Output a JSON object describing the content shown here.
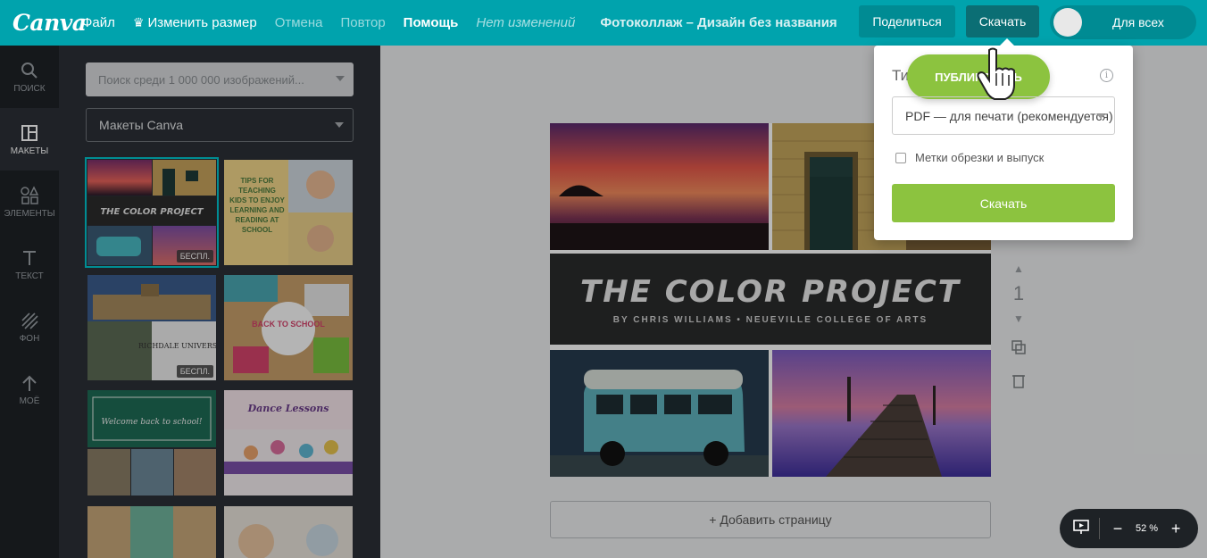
{
  "topbar": {
    "logo": "Canva",
    "menu": {
      "file": "Файл",
      "resize": "Изменить размер",
      "undo": "Отмена",
      "redo": "Повтор",
      "help": "Помощь",
      "status": "Нет изменений"
    },
    "title": "Фотоколлаж – Дизайн без названия",
    "share_label": "Поделиться",
    "download_label": "Скачать",
    "visibility_label": "Для всех"
  },
  "rail": {
    "items": [
      {
        "label": "Поиск",
        "icon": "search-icon"
      },
      {
        "label": "Макеты",
        "icon": "layout-icon"
      },
      {
        "label": "Элементы",
        "icon": "shapes-icon"
      },
      {
        "label": "Текст",
        "icon": "text-icon"
      },
      {
        "label": "Фон",
        "icon": "background-icon"
      },
      {
        "label": "Моё",
        "icon": "upload-icon"
      }
    ]
  },
  "panel": {
    "search_placeholder": "Поиск среди 1 000 000 изображений...",
    "category_select": "Макеты Canva",
    "templates": [
      {
        "title": "THE COLOR PROJECT",
        "badge": "БЕСПЛ."
      },
      {
        "title": "TIPS FOR TEACHING KIDS TO ENJOY LEARNING AND READING AT SCHOOL"
      },
      {
        "title": "RICHDALE UNIVERSITY",
        "badge": "БЕСПЛ."
      },
      {
        "title": "BACK TO SCHOOL"
      },
      {
        "title": "Welcome back to school!"
      },
      {
        "title": "Dance Lessons"
      }
    ]
  },
  "canvas": {
    "banner_title": "THE COLOR PROJECT",
    "banner_subtitle": "BY CHRIS WILLIAMS • NEUEVILLE COLLEGE OF ARTS",
    "page_number": "1",
    "add_page_label": "+ Добавить страницу",
    "zoom_value": "52 %"
  },
  "download_popup": {
    "title": "Тип файла",
    "publish_label": "ПУБЛИКОВАТЬ",
    "file_type": "PDF — для печати (рекомендуется)",
    "crop_marks_label": "Метки обрезки и выпуск",
    "download_button": "Скачать"
  },
  "colors": {
    "topbar": "#00a3ad",
    "rail": "#1e2226",
    "panel": "#2b3036",
    "accent_green": "#8cc33f"
  }
}
